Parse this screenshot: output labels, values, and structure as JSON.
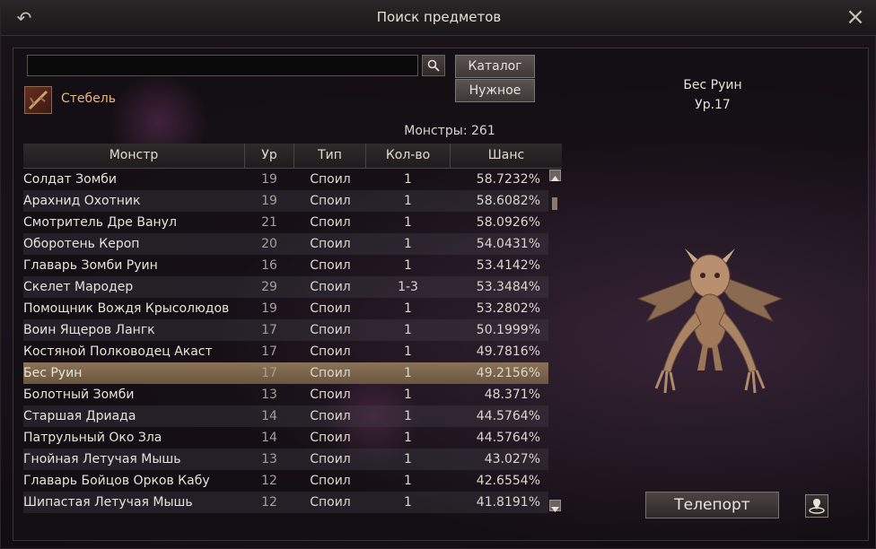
{
  "window": {
    "title": "Поиск предметов"
  },
  "search": {
    "value": "",
    "placeholder": ""
  },
  "buttons": {
    "catalog": "Каталог",
    "needed": "Нужное",
    "teleport": "Телепорт"
  },
  "item": {
    "name": "Стебель",
    "icon": "stem-item-icon"
  },
  "monsters_count": "Монстры: 261",
  "table": {
    "headers": [
      "Монстр",
      "Ур",
      "Тип",
      "Кол-во",
      "Шанс"
    ],
    "rows": [
      {
        "name": "Солдат Зомби",
        "level": "19",
        "type": "Споил",
        "qty": "1",
        "chance": "58.7232%"
      },
      {
        "name": "Арахнид Охотник",
        "level": "19",
        "type": "Споил",
        "qty": "1",
        "chance": "58.6082%"
      },
      {
        "name": "Смотритель Дре Ванул",
        "level": "21",
        "type": "Споил",
        "qty": "1",
        "chance": "58.0926%"
      },
      {
        "name": "Оборотень Кероп",
        "level": "20",
        "type": "Споил",
        "qty": "1",
        "chance": "54.0431%"
      },
      {
        "name": "Главарь Зомби Руин",
        "level": "16",
        "type": "Споил",
        "qty": "1",
        "chance": "53.4142%"
      },
      {
        "name": "Скелет Мародер",
        "level": "29",
        "type": "Споил",
        "qty": "1-3",
        "chance": "53.3484%"
      },
      {
        "name": "Помощник Вождя Крысолюдов",
        "level": "19",
        "type": "Споил",
        "qty": "1",
        "chance": "53.2802%"
      },
      {
        "name": "Воин Ящеров Лангк",
        "level": "17",
        "type": "Споил",
        "qty": "1",
        "chance": "50.1999%"
      },
      {
        "name": "Костяной Полководец Акаст",
        "level": "17",
        "type": "Споил",
        "qty": "1",
        "chance": "49.7816%"
      },
      {
        "name": "Бес Руин",
        "level": "17",
        "type": "Споил",
        "qty": "1",
        "chance": "49.2156%",
        "selected": true
      },
      {
        "name": "Болотный Зомби",
        "level": "13",
        "type": "Споил",
        "qty": "1",
        "chance": "48.371%"
      },
      {
        "name": "Старшая Дриада",
        "level": "14",
        "type": "Споил",
        "qty": "1",
        "chance": "44.5764%"
      },
      {
        "name": "Патрульный Око Зла",
        "level": "14",
        "type": "Споил",
        "qty": "1",
        "chance": "44.5764%"
      },
      {
        "name": "Гнойная Летучая Мышь",
        "level": "13",
        "type": "Споил",
        "qty": "1",
        "chance": "43.027%"
      },
      {
        "name": "Главарь Бойцов Орков Кабу",
        "level": "12",
        "type": "Споил",
        "qty": "1",
        "chance": "42.6554%"
      },
      {
        "name": "Шипастая Летучая Мышь",
        "level": "12",
        "type": "Споил",
        "qty": "1",
        "chance": "41.8191%"
      }
    ]
  },
  "target": {
    "name": "Бес Руин",
    "level": "Ур.17"
  },
  "colors": {
    "selected_row": "#7d6850",
    "item_name": "#e9b77a",
    "level_text": "#a89f95"
  }
}
